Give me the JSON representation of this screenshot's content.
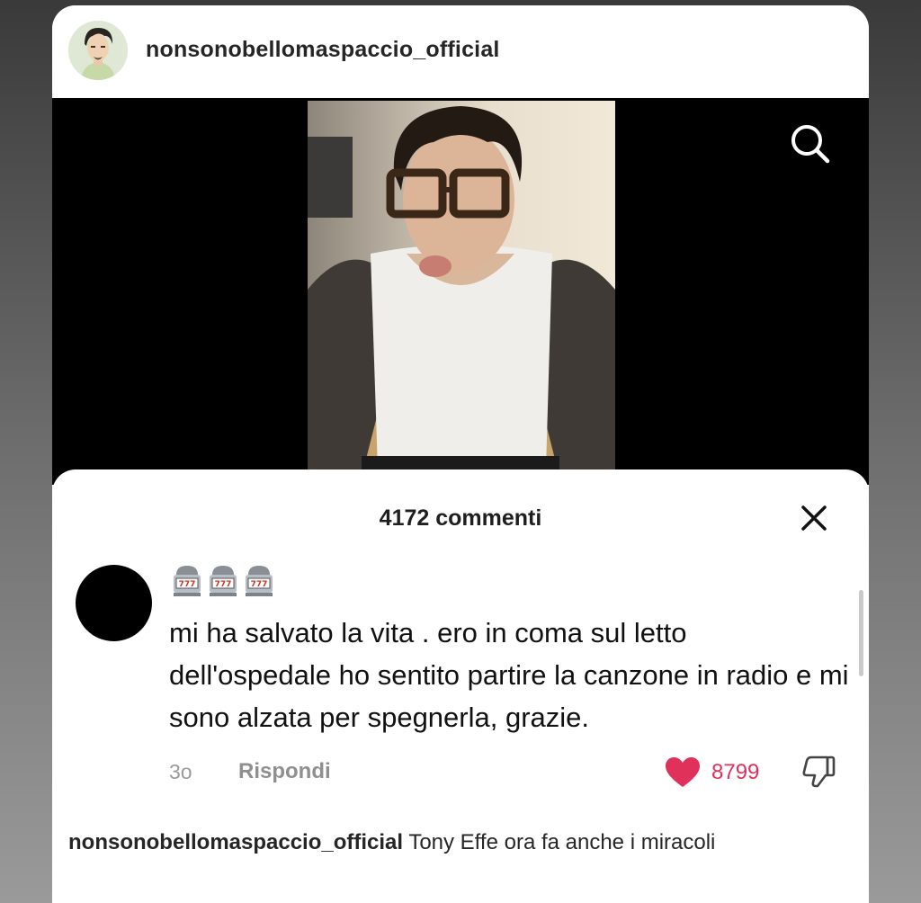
{
  "post": {
    "username": "nonsonobellomaspaccio_official"
  },
  "comments_sheet": {
    "count_label": "4172 commenti",
    "comment": {
      "emojis": [
        "slot-machine",
        "slot-machine",
        "slot-machine"
      ],
      "text": "mi ha salvato la vita . ero in coma sul letto dell'ospedale ho sentito partire la canzone in radio e mi sono alzata per spegnerla, grazie.",
      "time": "3o",
      "reply_label": "Rispondi",
      "likes": "8799",
      "like_color": "#e0315b"
    }
  },
  "caption": {
    "username": "nonsonobellomaspaccio_official",
    "text": "Tony Effe ora fa anche i miracoli"
  },
  "icons": {
    "search": "search-icon",
    "close": "close-icon",
    "like": "heart-icon",
    "dislike": "thumbs-down-icon"
  }
}
